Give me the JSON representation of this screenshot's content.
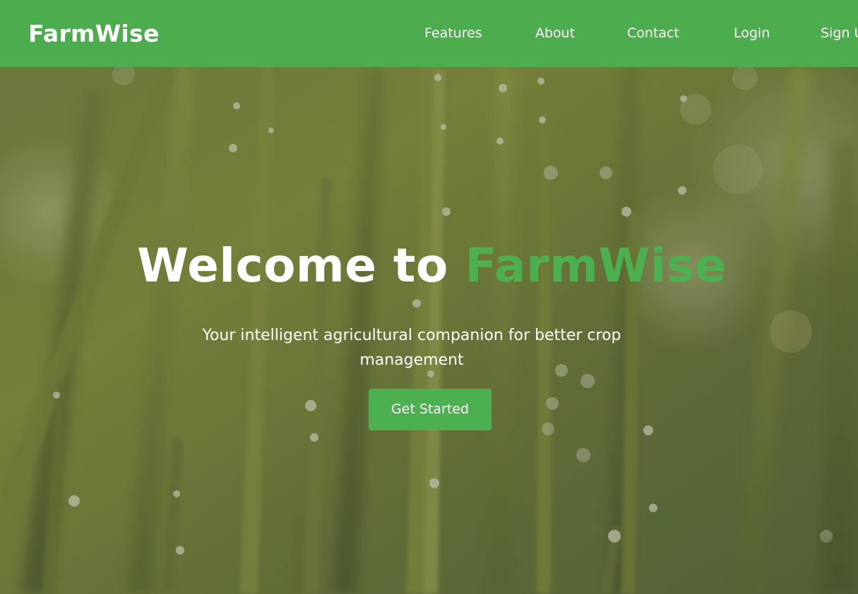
{
  "brand": {
    "name": "FarmWise",
    "color": "#4caf50"
  },
  "nav": {
    "items": [
      {
        "label": "Features"
      },
      {
        "label": "About"
      },
      {
        "label": "Contact"
      },
      {
        "label": "Login"
      },
      {
        "label": "Sign Up"
      }
    ]
  },
  "hero": {
    "title_prefix": "Welcome to",
    "title_accent": "FarmWise",
    "subtitle": "Your intelligent agricultural companion for better crop management",
    "cta_label": "Get Started",
    "background": "grass-with-dew-photo"
  }
}
